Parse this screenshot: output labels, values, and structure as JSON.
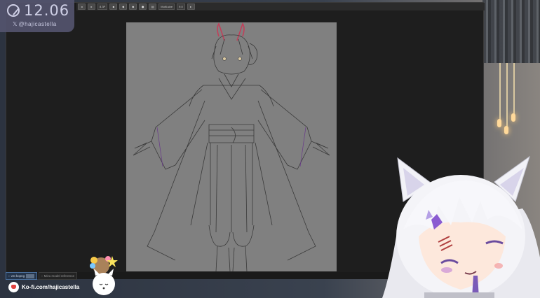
{
  "overlay": {
    "clock_time": "12.06",
    "social_handle": "@hajicastella"
  },
  "toolbar": {
    "zoom_value": "8.3P",
    "brush_label": "Multi-size",
    "size_value": "9.0"
  },
  "tabs": [
    {
      "label": "ver.kopng",
      "active": true
    },
    {
      "label": "Mizu model reference",
      "active": false
    }
  ],
  "kofi": {
    "label": "Ko-fi.com/hajicastella"
  },
  "colors": {
    "overlay_bg": "#54546e",
    "canvas_paper": "#808080",
    "app_bg": "#1e1e1e",
    "accent_horn": "#c0405a",
    "kofi_heart": "#e2433f"
  }
}
